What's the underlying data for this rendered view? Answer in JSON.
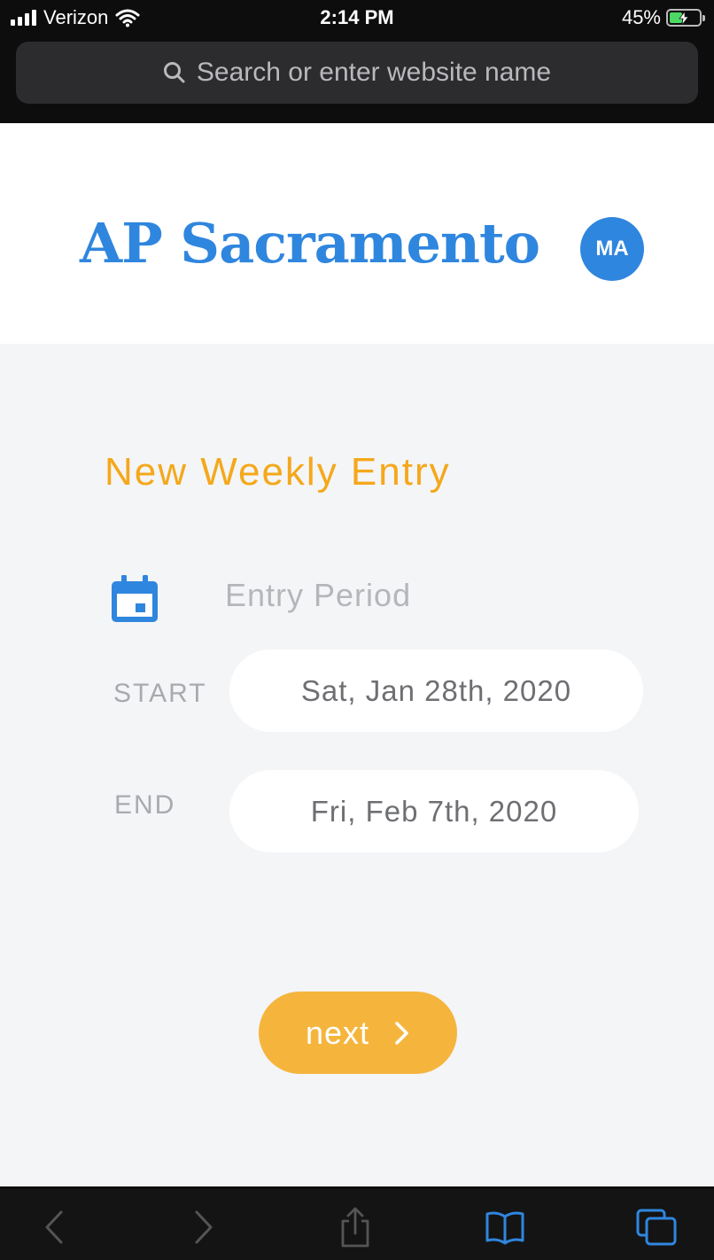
{
  "status_bar": {
    "carrier": "Verizon",
    "time": "2:14 PM",
    "battery_percent_text": "45%",
    "battery_level": 0.45,
    "battery_color": "#4cd964"
  },
  "browser": {
    "url_placeholder": "Search or enter website name",
    "search_icon": "magnifier"
  },
  "app": {
    "brand": "AP Sacramento",
    "brand_color": "#2f86de",
    "avatar_initials": "MA"
  },
  "form": {
    "title": "New Weekly Entry",
    "title_color": "#f4a81b",
    "period_icon": "calendar-icon",
    "period_label": "Entry Period",
    "start_label": "START",
    "start_value": "Sat, Jan 28th, 2020",
    "end_label": "END",
    "end_value": "Fri, Feb 7th, 2020",
    "next_label": "next",
    "next_color": "#f5b53d"
  },
  "toolbar": {
    "icons": [
      "back-arrow-icon",
      "forward-arrow-icon",
      "share-icon",
      "bookmarks-icon",
      "tabs-icon"
    ],
    "active_color": "#2f86de"
  }
}
